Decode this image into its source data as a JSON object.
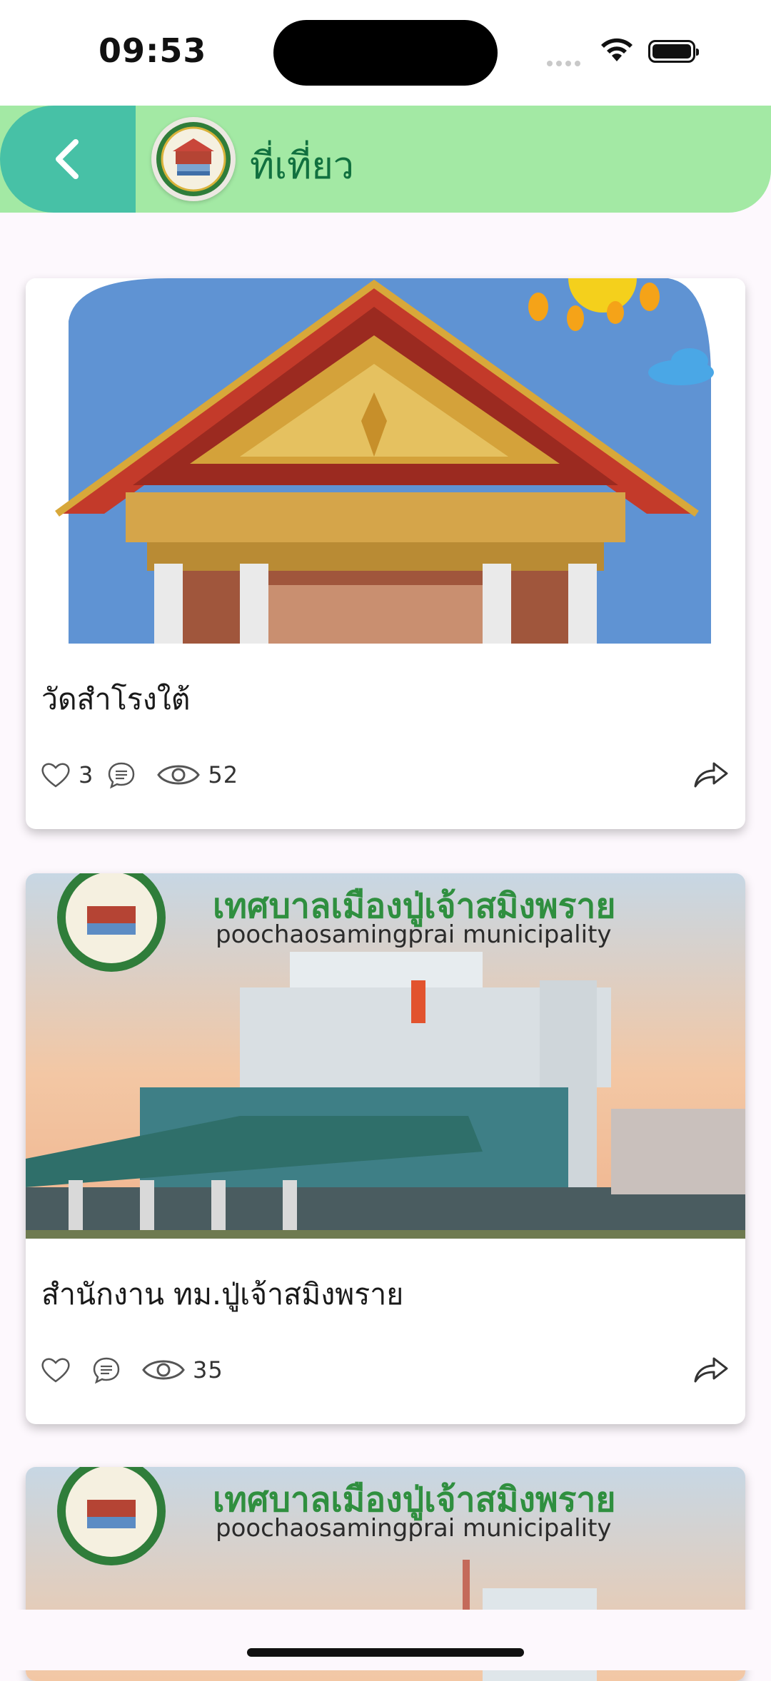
{
  "status_bar": {
    "time": "09:53"
  },
  "header": {
    "title": "ที่เที่ยว",
    "logo_icon": "municipality-seal-icon",
    "back_icon": "chevron-left-icon"
  },
  "cards": [
    {
      "title": "วัดสำโรงใต้",
      "likes": "3",
      "comments": "",
      "views": "52",
      "image_icon": "temple-photo"
    },
    {
      "title": "สำนักงาน ทม.ปู่เจ้าสมิงพราย",
      "likes": "",
      "comments": "",
      "views": "35",
      "image_icon": "municipality-building-photo",
      "banner_th": "เทศบาลเมืองปู่เจ้าสมิงพราย",
      "banner_en": "poochaosamingprai municipality"
    },
    {
      "image_icon": "municipality-building-photo",
      "banner_th": "เทศบาลเมืองปู่เจ้าสมิงพราย",
      "banner_en": "poochaosamingprai municipality"
    }
  ],
  "colors": {
    "header_bg": "#a3e9a4",
    "back_bg": "#47c1a6",
    "title_green": "#11703f"
  }
}
